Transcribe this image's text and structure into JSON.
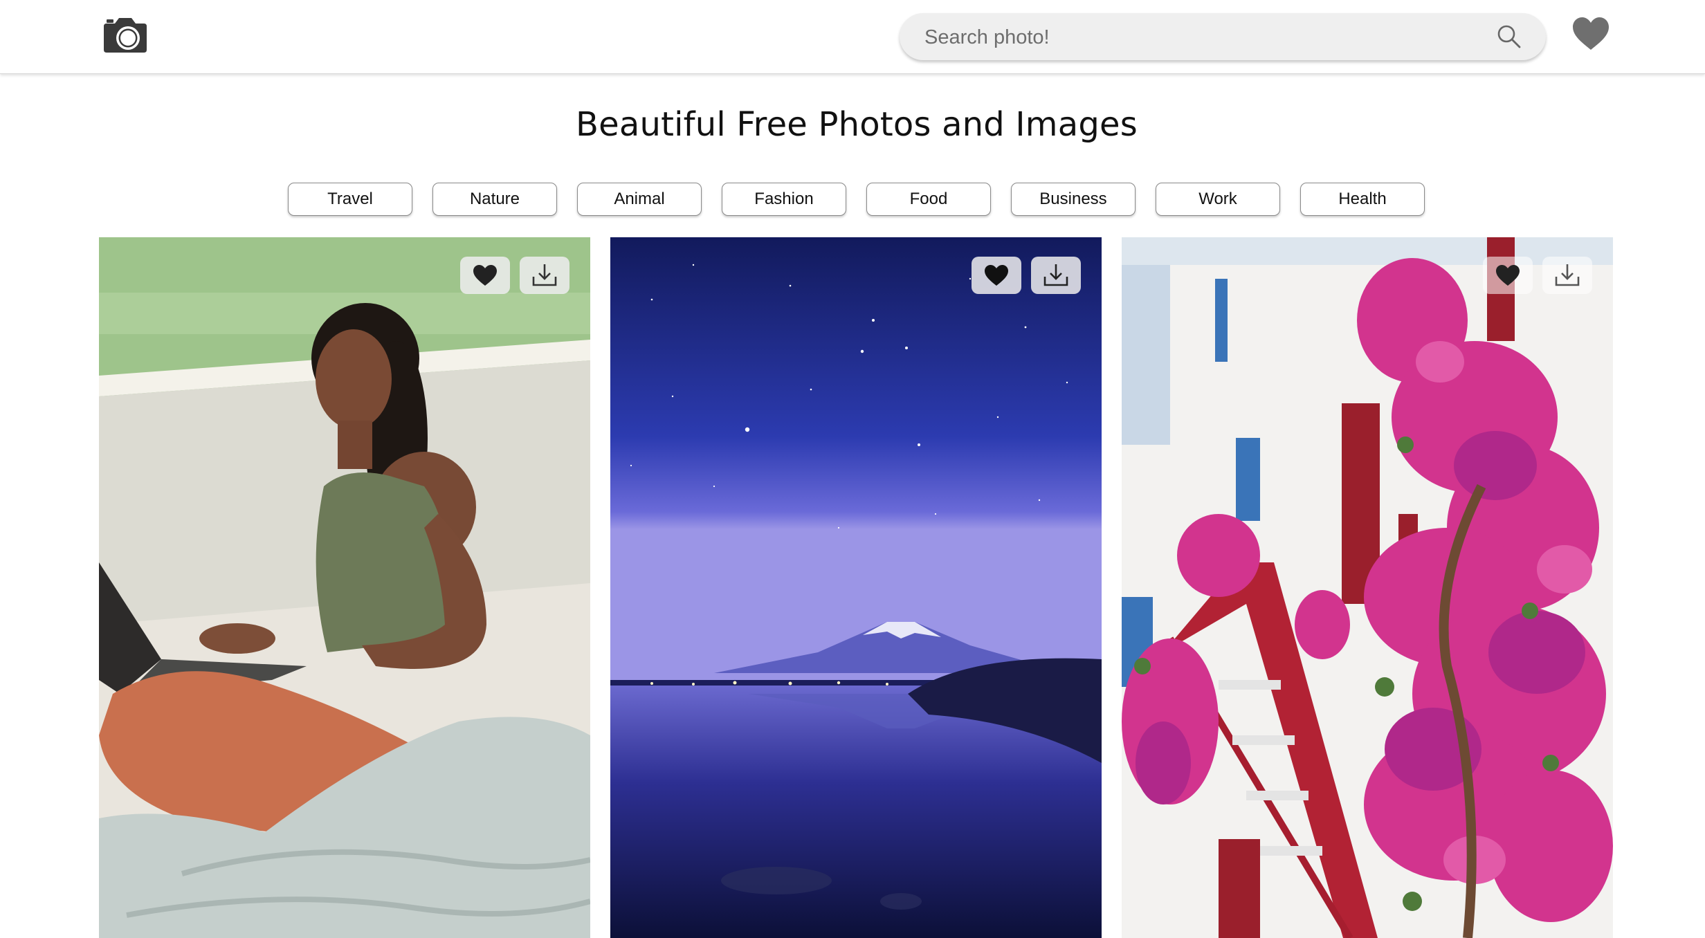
{
  "header": {
    "logo_icon": "camera-icon",
    "search": {
      "placeholder": "Search photo!",
      "value": "",
      "icon": "search-icon"
    },
    "favorites_icon": "heart-icon"
  },
  "page": {
    "title": "Beautiful Free Photos and Images"
  },
  "categories": [
    "Travel",
    "Nature",
    "Animal",
    "Fashion",
    "Food",
    "Business",
    "Work",
    "Health"
  ],
  "photos": [
    {
      "subject": "woman-with-laptop",
      "actions": [
        "heart-icon",
        "download-icon"
      ]
    },
    {
      "subject": "mountain-lake-night-sky",
      "actions": [
        "heart-icon",
        "download-icon"
      ]
    },
    {
      "subject": "bougainvillea-white-house",
      "actions": [
        "heart-icon",
        "download-icon"
      ]
    }
  ],
  "colors": {
    "header_bg": "#ffffff",
    "search_bg": "#efefef",
    "icon_gray": "#6f6f6f",
    "button_border": "#8a8a8a"
  }
}
